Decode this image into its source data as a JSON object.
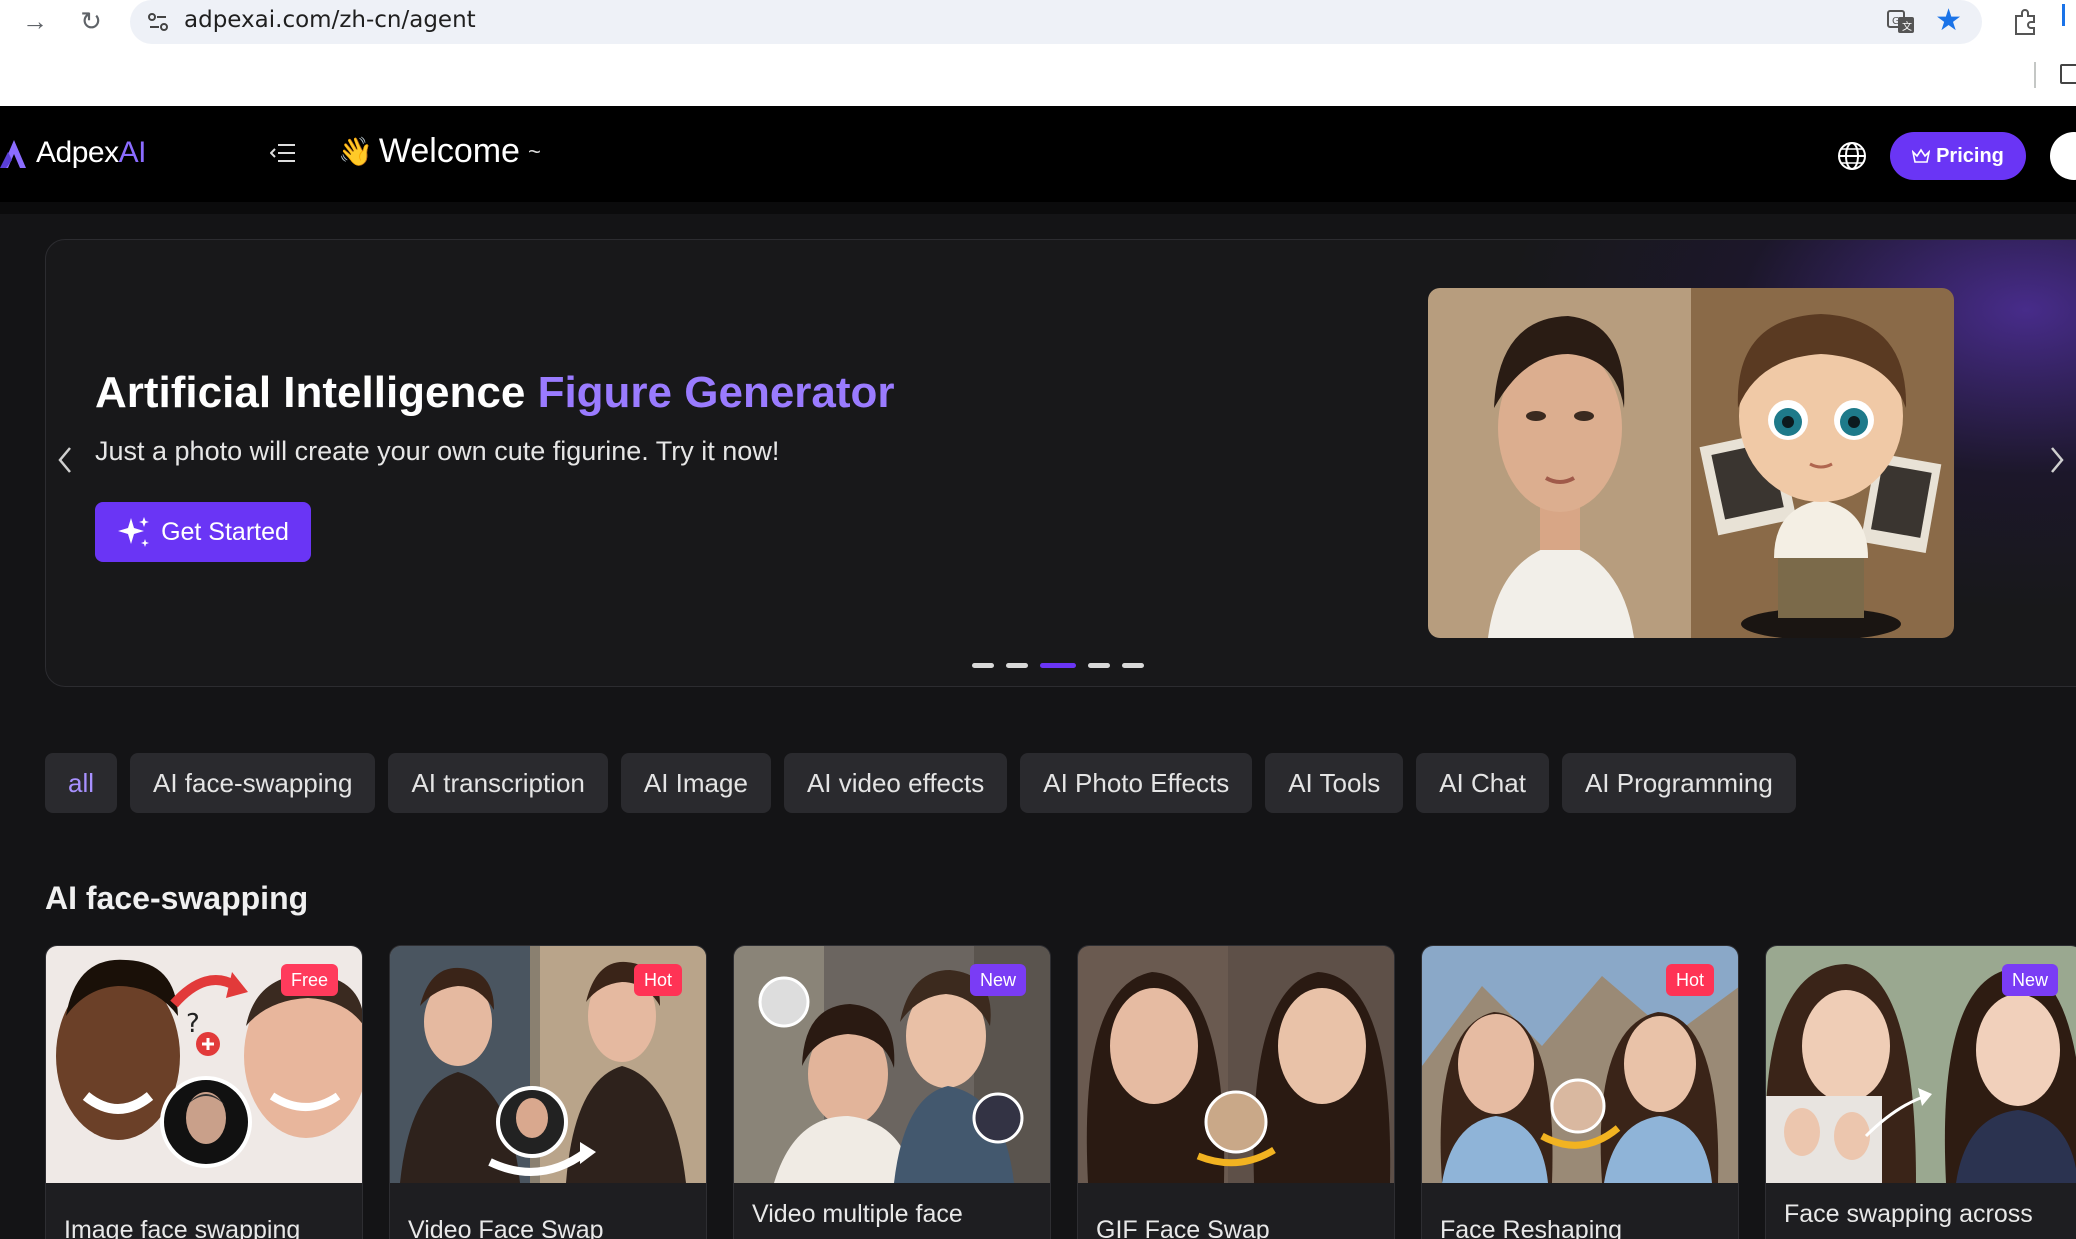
{
  "browser": {
    "url": "adpexai.com/zh-cn/agent"
  },
  "header": {
    "logo_main": "Adpex",
    "logo_ai": "AI",
    "welcome": "Welcome",
    "welcome_suffix": "~",
    "pricing_label": "Pricing"
  },
  "hero": {
    "title_white": "Artificial Intelligence",
    "title_accent": "Figure Generator",
    "subtitle": "Just a photo will create your own cute figurine. Try it now!",
    "cta_label": "Get Started",
    "slides_total": 5,
    "slide_active": 3
  },
  "categories": [
    {
      "label": "all",
      "active": true
    },
    {
      "label": "AI face-swapping",
      "active": false
    },
    {
      "label": "AI transcription",
      "active": false
    },
    {
      "label": "AI Image",
      "active": false
    },
    {
      "label": "AI video effects",
      "active": false
    },
    {
      "label": "AI Photo Effects",
      "active": false
    },
    {
      "label": "AI Tools",
      "active": false
    },
    {
      "label": "AI Chat",
      "active": false
    },
    {
      "label": "AI Programming",
      "active": false
    }
  ],
  "section": {
    "title": "AI face-swapping"
  },
  "cards": [
    {
      "title": "Image face swapping",
      "badge": "Free",
      "badge_type": "free"
    },
    {
      "title": "Video Face Swap",
      "badge": "Hot",
      "badge_type": "hot"
    },
    {
      "title": "Video multiple face",
      "badge": "New",
      "badge_type": "new"
    },
    {
      "title": "GIF Face Swap",
      "badge": "",
      "badge_type": ""
    },
    {
      "title": "Face Reshaping",
      "badge": "Hot",
      "badge_type": "hot"
    },
    {
      "title": "Face swapping across",
      "badge": "New",
      "badge_type": "new"
    }
  ],
  "colors": {
    "accent": "#6a35f5",
    "accent_text": "#9a7bff",
    "background": "#141416"
  }
}
